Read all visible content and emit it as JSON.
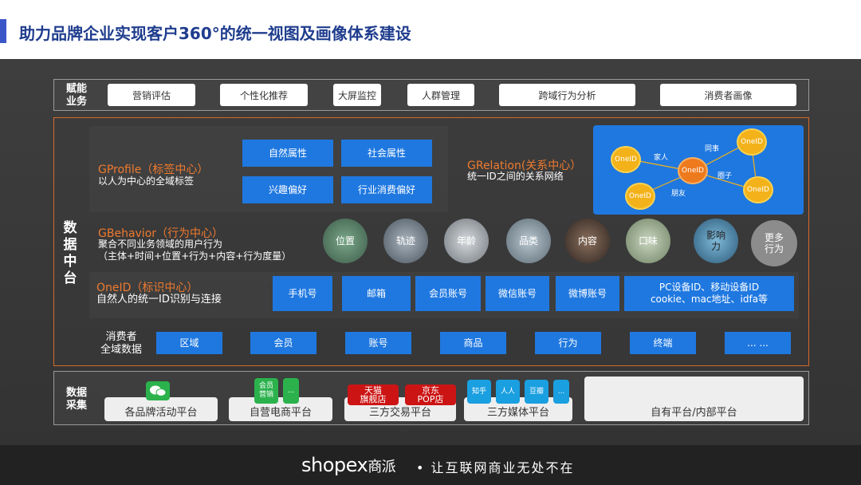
{
  "header": {
    "title": "助力品牌企业实现客户360°的统一视图及画像体系建设"
  },
  "enable": {
    "label": "赋能\n业务",
    "items": [
      "营销评估",
      "个性化推荐",
      "大屏监控",
      "人群管理",
      "跨域行为分析",
      "消费者画像"
    ]
  },
  "platform": {
    "label": "数\n据\n中\n台"
  },
  "gprofile": {
    "title": "GProfile（标签中心）",
    "subtitle": "以人为中心的全域标签",
    "tags": [
      "自然属性",
      "社会属性",
      "兴趣偏好",
      "行业消费偏好"
    ]
  },
  "grelation": {
    "title": "GRelation(关系中心）",
    "subtitle": "统一ID之间的关系网络",
    "nodes": [
      "OneID",
      "OneID",
      "OneID",
      "OneID",
      "OneID"
    ],
    "relations": [
      "家人",
      "同事",
      "朋友",
      "圈子"
    ]
  },
  "gbehavior": {
    "title": "GBehavior（行为中心）",
    "line1": "聚合不同业务领域的用户行为",
    "line2": "（主体+时间+位置+行为+内容+行为度量）",
    "items": [
      "位置",
      "轨迹",
      "年龄",
      "品类",
      "内容",
      "口味",
      "影响力",
      "更多行为"
    ]
  },
  "oneid": {
    "title": "OneID（标识中心）",
    "subtitle": "自然人的统一ID识别与连接",
    "ids": [
      "手机号",
      "邮箱",
      "会员账号",
      "微信账号",
      "微博账号",
      "PC设备ID、移动设备ID\ncookie、mac地址、idfa等"
    ]
  },
  "consumer": {
    "label": "消费者\n全域数据",
    "items": [
      "区域",
      "会员",
      "账号",
      "商品",
      "行为",
      "终端",
      "... ..."
    ]
  },
  "collect": {
    "label": "数据\n采集",
    "platforms": [
      "各品牌活动平台",
      "自营电商平台",
      "三方交易平台",
      "三方媒体平台",
      "自有平台/内部平台"
    ],
    "ecom_tiles": [
      "会员\n营销",
      "..."
    ],
    "trade_tiles": [
      "天猫\n旗舰店",
      "京东\nPOP店"
    ],
    "media_tiles": [
      "知乎",
      "人人",
      "豆瓣",
      "..."
    ]
  },
  "footer": {
    "logo": "shopex",
    "logo_cn": "商派",
    "slogan": "• 让互联网商业无处不在"
  },
  "colors": {
    "accent_blue": "#1f78e0",
    "accent_orange": "#ef7a2e",
    "title_blue": "#1f3d8e",
    "node_yellow": "#f3b21a"
  }
}
